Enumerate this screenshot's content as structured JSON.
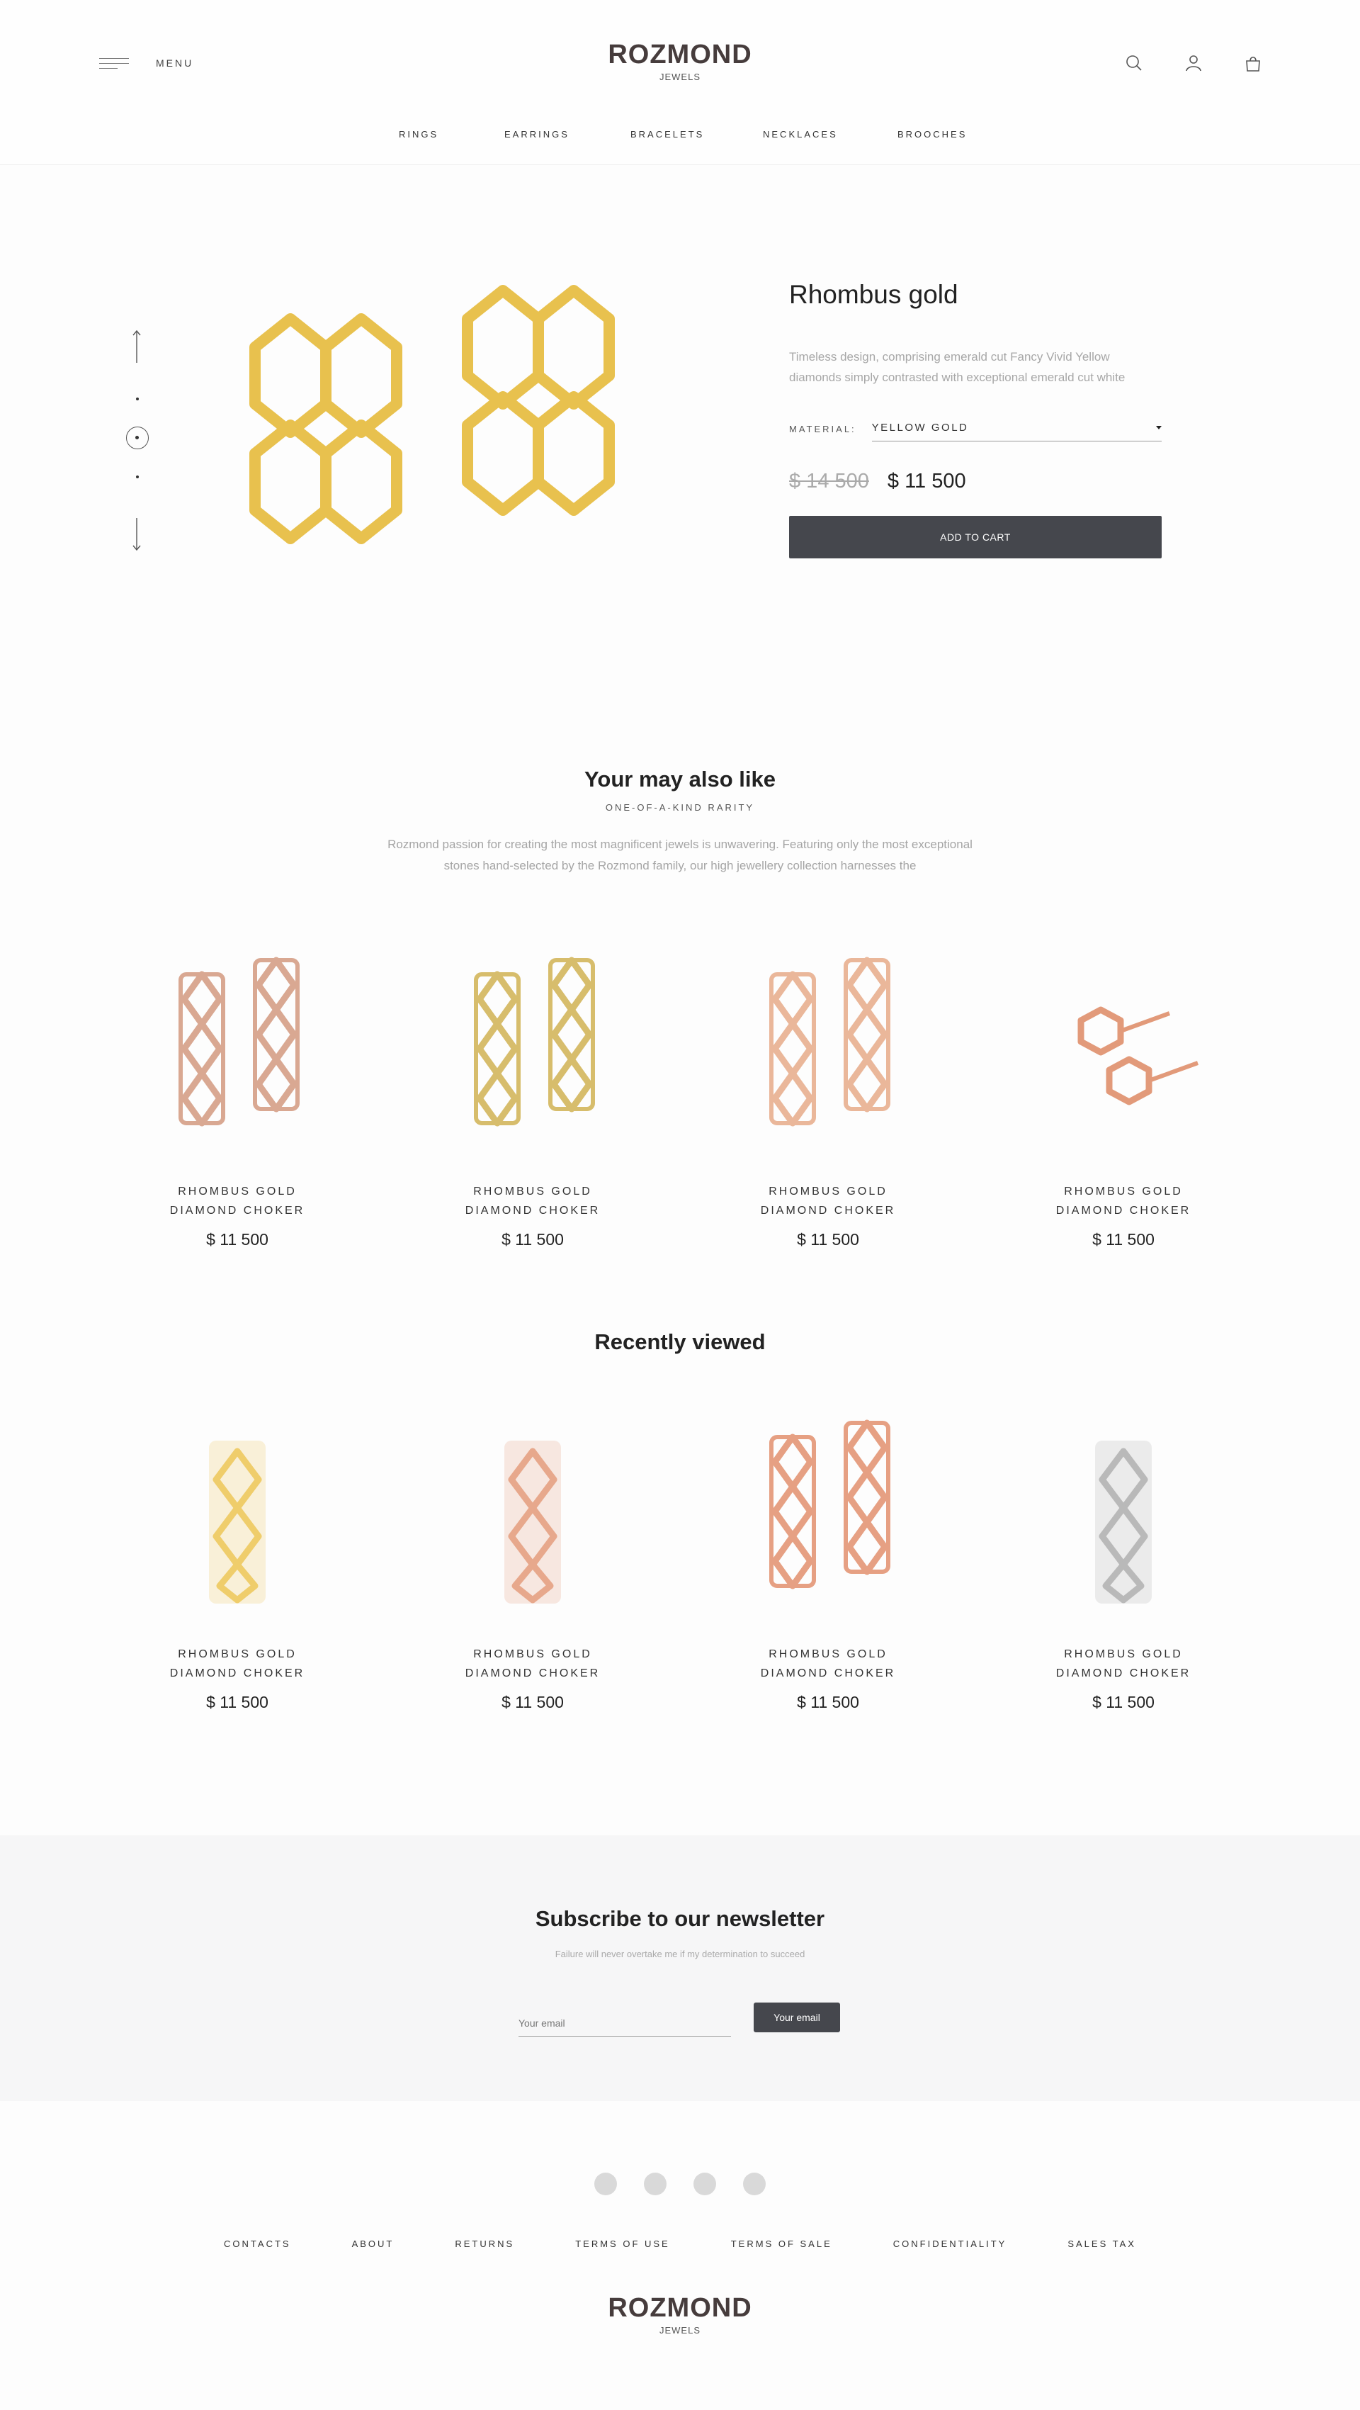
{
  "header": {
    "menu_label": "MENU",
    "brand": "ROZMOND",
    "brand_sub": "JEWELS",
    "icons": [
      "search-icon",
      "user-icon",
      "bag-icon"
    ],
    "nav": [
      "RINGS",
      "EARRINGS",
      "BRACELETS",
      "NECKLACES",
      "BROOCHES"
    ]
  },
  "product": {
    "title": "Rhombus gold",
    "description": "Timeless design, comprising emerald cut Fancy Vivid Yellow diamonds simply contrasted with exceptional emerald cut white",
    "material_label": "MATERIAL:",
    "material_value": "YELLOW GOLD",
    "old_price": "$ 14 500",
    "price": "$ 11 500",
    "add_to_cart": "ADD TO CART",
    "image_color": "#e8c14e"
  },
  "also_like": {
    "title": "Your may also like",
    "kicker": "ONE-OF-A-KIND RARITY",
    "text": "Rozmond passion for creating the most magnificent jewels is unwavering. Featuring only the most exceptional stones hand-selected by the Rozmond family, our high jewellery collection harnesses the",
    "items": [
      {
        "name1": "RHOMBUS GOLD",
        "name2": "DIAMOND CHOKER",
        "price": "$ 11 500",
        "color": "#d9a892"
      },
      {
        "name1": "RHOMBUS GOLD",
        "name2": "DIAMOND CHOKER",
        "price": "$ 11 500",
        "color": "#d7bd6c"
      },
      {
        "name1": "RHOMBUS GOLD",
        "name2": "DIAMOND CHOKER",
        "price": "$ 11 500",
        "color": "#eab79a"
      },
      {
        "name1": "RHOMBUS GOLD",
        "name2": "DIAMOND CHOKER",
        "price": "$ 11 500",
        "color": "#e29a7a"
      }
    ]
  },
  "recently_viewed": {
    "title": "Recently viewed",
    "items": [
      {
        "name1": "RHOMBUS GOLD",
        "name2": "DIAMOND CHOKER",
        "price": "$ 11 500",
        "color": "#efcd6b"
      },
      {
        "name1": "RHOMBUS GOLD",
        "name2": "DIAMOND CHOKER",
        "price": "$ 11 500",
        "color": "#e7a88c"
      },
      {
        "name1": "RHOMBUS GOLD",
        "name2": "DIAMOND CHOKER",
        "price": "$ 11 500",
        "color": "#e6a083"
      },
      {
        "name1": "RHOMBUS GOLD",
        "name2": "DIAMOND CHOKER",
        "price": "$ 11 500",
        "color": "#b9b9b9"
      }
    ]
  },
  "newsletter": {
    "title": "Subscribe to our newsletter",
    "subtitle": "Failure will never overtake me if my determination to succeed",
    "placeholder": "Your email",
    "button": "Your email"
  },
  "footer": {
    "links": [
      "CONTACTS",
      "ABOUT",
      "RETURNS",
      "TERMS OF USE",
      "TERMS OF SALE",
      "CONFIDENTIALITY",
      "SALES TAX"
    ],
    "brand": "ROZMOND",
    "brand_sub": "JEWELS"
  }
}
